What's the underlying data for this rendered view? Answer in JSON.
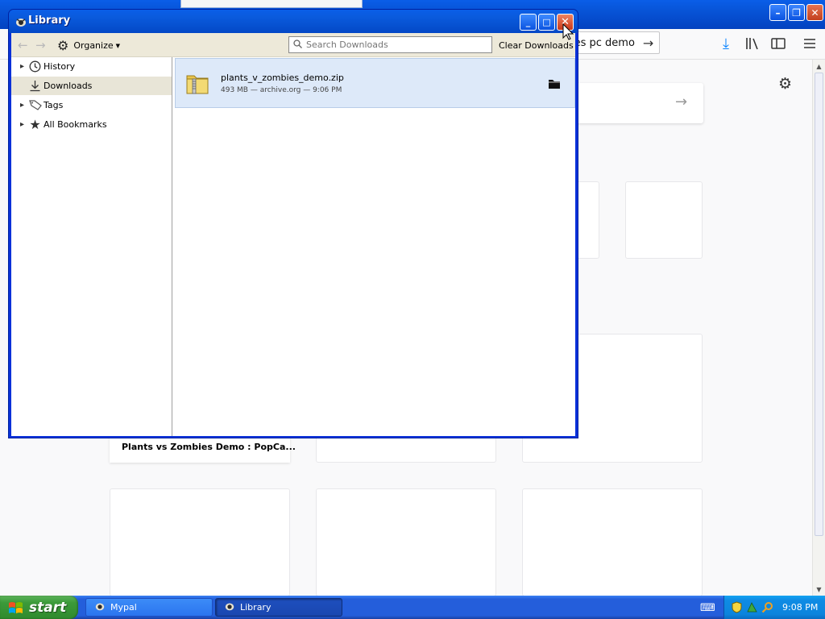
{
  "background_browser": {
    "url_fragment": "ies pc demo",
    "tile_caption": "Plants vs Zombies Demo : PopCa...",
    "icons": [
      "download-icon",
      "library-icon",
      "sidebar-icon",
      "menu-icon",
      "gear-icon",
      "go-arrow-icon"
    ],
    "window_buttons": {
      "minimize": "–",
      "restore": "❐",
      "close": "✕"
    }
  },
  "library_window": {
    "title": "Library",
    "window_buttons": {
      "minimize": "_",
      "maximize": "□",
      "close": "✕"
    },
    "toolbar": {
      "back_icon": "←",
      "forward_icon": "→",
      "organize_label": "Organize",
      "search_placeholder": "Search Downloads",
      "clear_label": "Clear Downloads"
    },
    "sidebar": {
      "items": [
        {
          "label": "History",
          "icon": "clock-icon",
          "expandable": true
        },
        {
          "label": "Downloads",
          "icon": "download-icon",
          "expandable": false,
          "selected": true
        },
        {
          "label": "Tags",
          "icon": "tag-icon",
          "expandable": true
        },
        {
          "label": "All Bookmarks",
          "icon": "star-icon",
          "expandable": true
        }
      ]
    },
    "downloads": [
      {
        "filename": "plants_v_zombies_demo.zip",
        "meta": "493 MB — archive.org — 9:06 PM",
        "icon": "zip-file-icon",
        "action_icon": "folder-icon"
      }
    ]
  },
  "taskbar": {
    "start_label": "start",
    "tasks": [
      {
        "label": "Mypal",
        "active": false
      },
      {
        "label": "Library",
        "active": true
      }
    ],
    "clock": "9:08 PM"
  }
}
